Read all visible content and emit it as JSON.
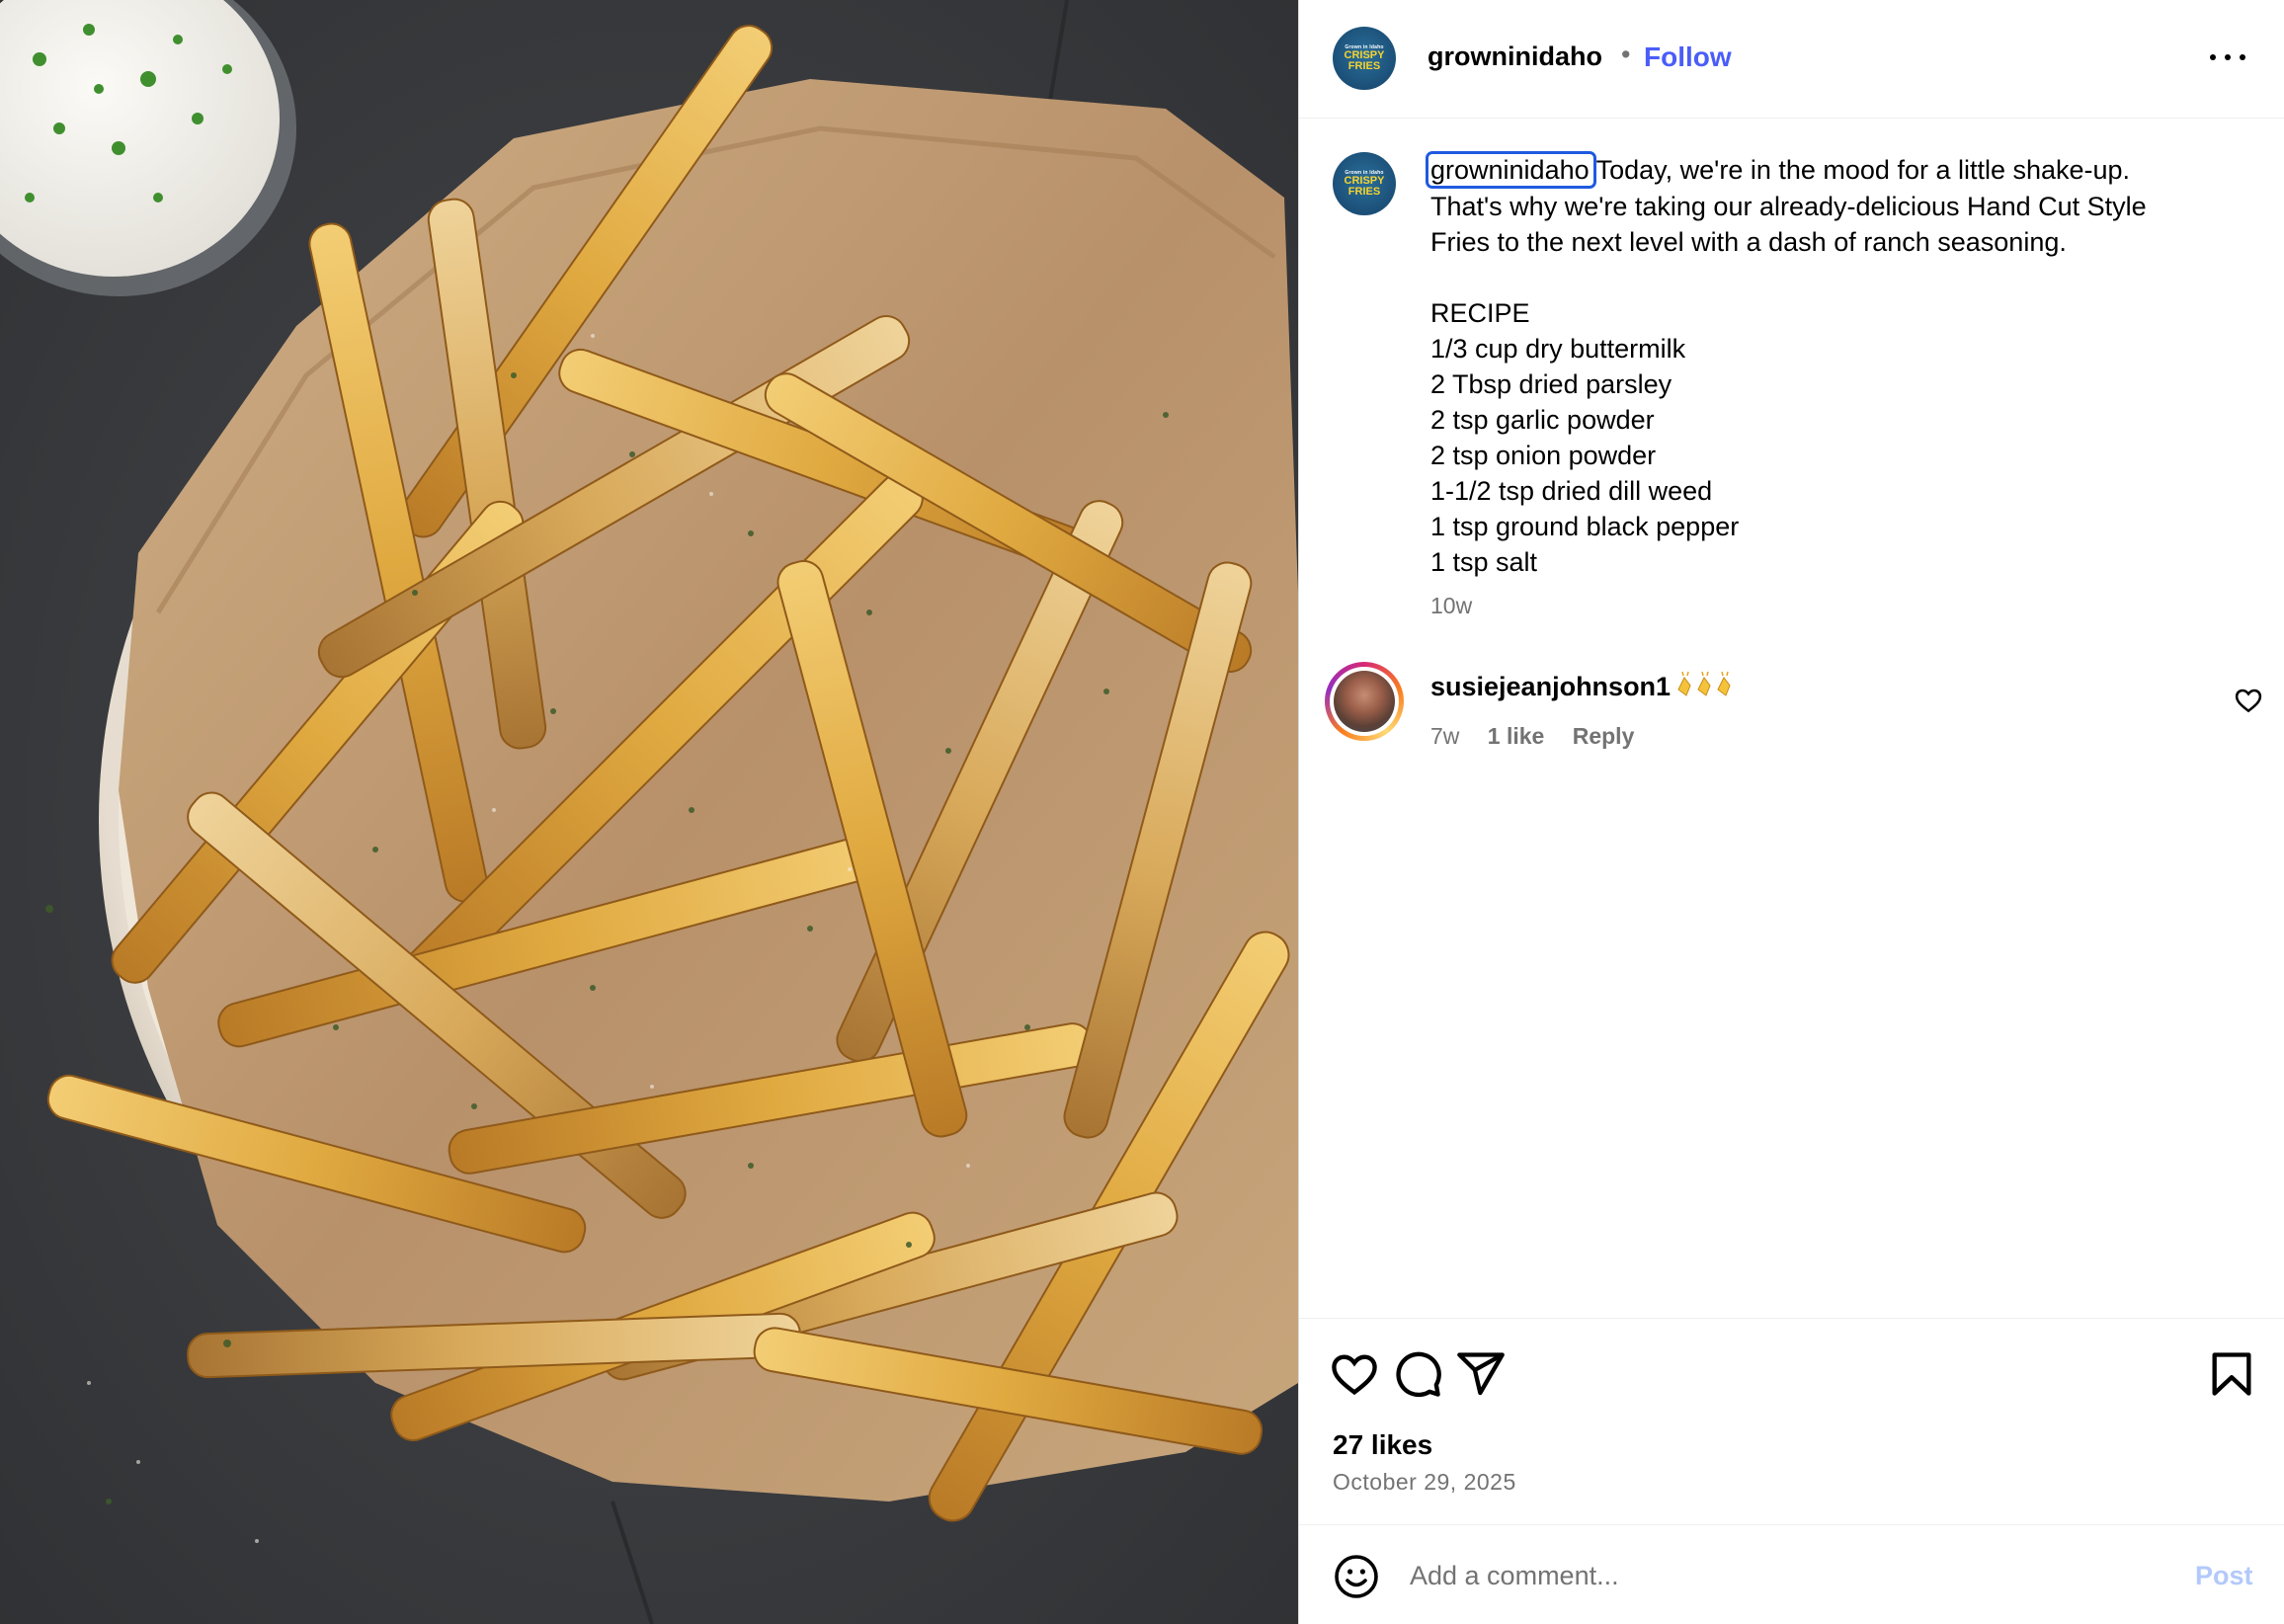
{
  "post": {
    "username": "growninidaho",
    "follow_label": "Follow",
    "separator": "•",
    "more_icon": "more-horizontal-icon",
    "avatar_logo": {
      "line1": "Grown in Idaho",
      "line2": "CRISPY",
      "line3": "FRIES"
    },
    "caption_lines": [
      "Today, we're in the mood for a little shake-up.",
      "That's why we're taking our already-delicious Hand Cut Style",
      "Fries to the next level with a dash of ranch seasoning.",
      "",
      "RECIPE",
      "1/3 cup dry buttermilk",
      "2 Tbsp dried parsley",
      "2 tsp garlic powder",
      "2 tsp onion powder",
      "1-1/2 tsp dried dill weed",
      "1 tsp ground black pepper",
      "1 tsp salt"
    ],
    "time_ago": "10w",
    "likes": "27 likes",
    "date": "October 29, 2025"
  },
  "comments": [
    {
      "username": "susiejeanjohnson1",
      "emoji_icon": "clapping-hands-icon",
      "time_ago": "7w",
      "likes": "1 like",
      "reply_label": "Reply"
    }
  ],
  "actions": {
    "like_icon": "heart-icon",
    "comment_icon": "comment-bubble-icon",
    "share_icon": "share-paper-plane-icon",
    "save_icon": "bookmark-icon"
  },
  "add_comment": {
    "placeholder": "Add a comment...",
    "post_label": "Post",
    "emoji_icon": "smiley-icon"
  },
  "colors": {
    "link_blue": "#4a5df9",
    "focus_ring": "#1f5ae0",
    "muted_text": "#737373",
    "post_disabled": "#b3c9fb"
  }
}
